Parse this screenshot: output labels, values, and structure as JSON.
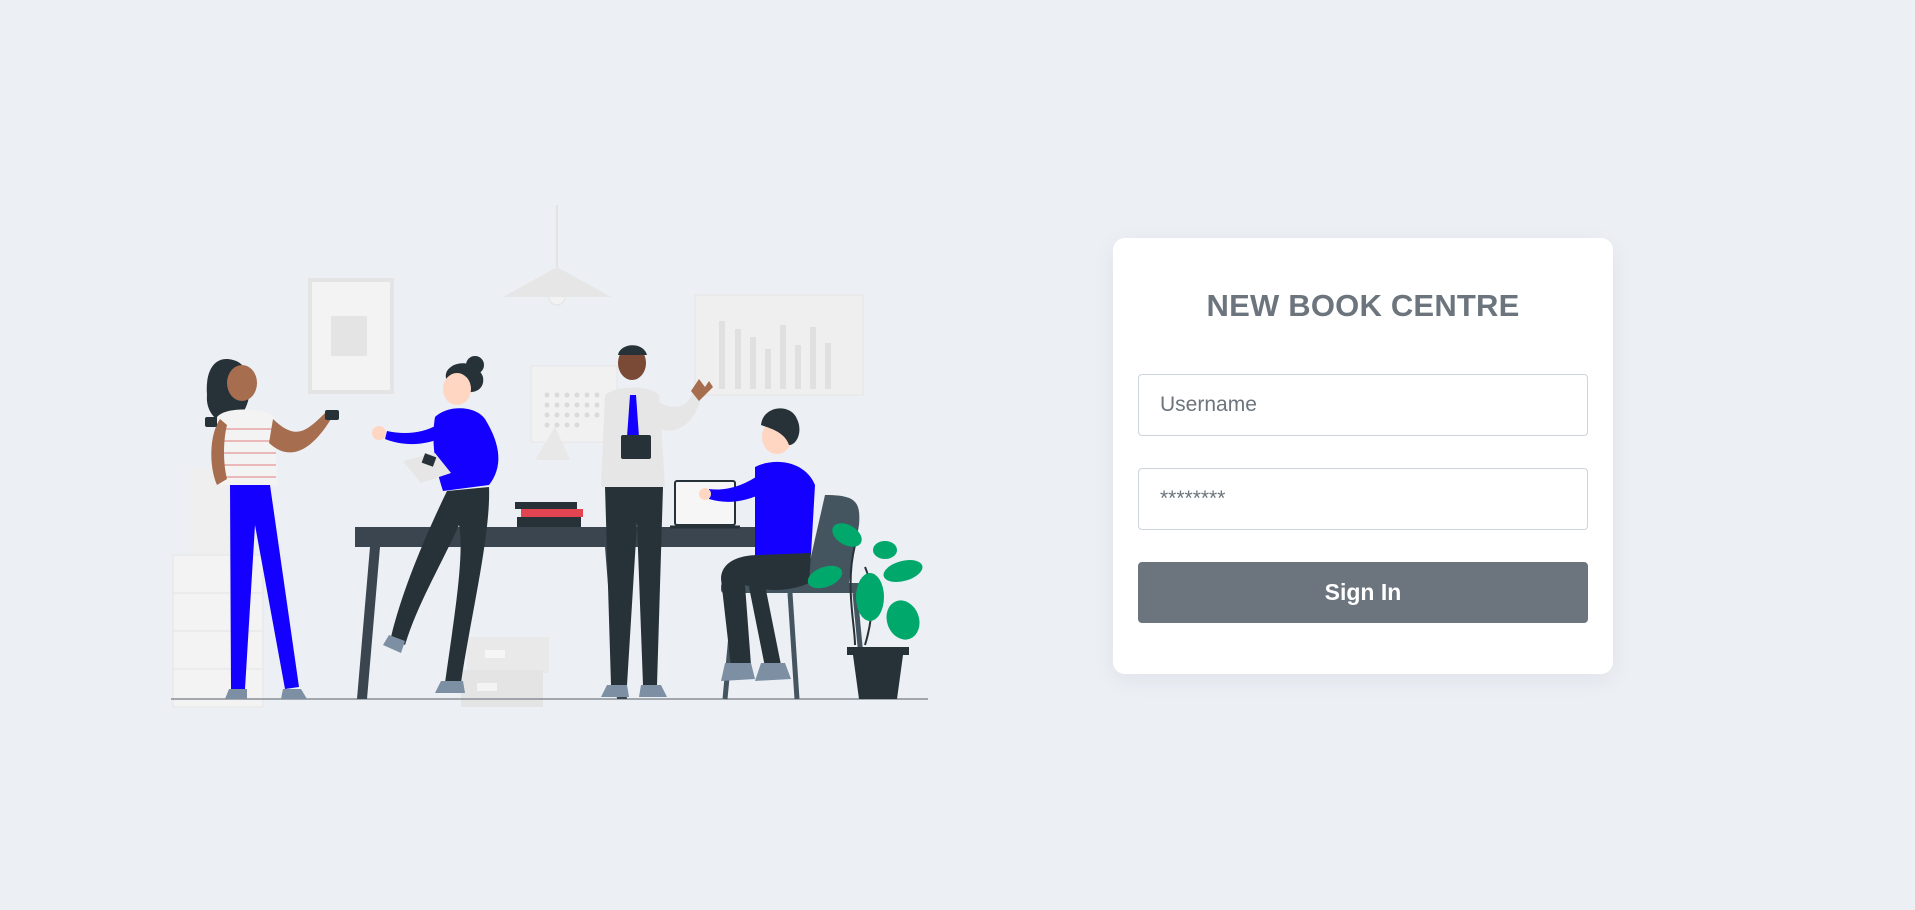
{
  "login": {
    "title": "NEW BOOK CENTRE",
    "username_placeholder": "Username",
    "password_placeholder": "********",
    "signin_label": "Sign In"
  },
  "illustration": {
    "name": "team-meeting-illustration"
  },
  "colors": {
    "background": "#eceff4",
    "card": "#ffffff",
    "title": "#6c757d",
    "button": "#6c757d",
    "accent_blue": "#1400ff",
    "dark_clothing": "#263238",
    "plant_green": "#00a86b"
  }
}
